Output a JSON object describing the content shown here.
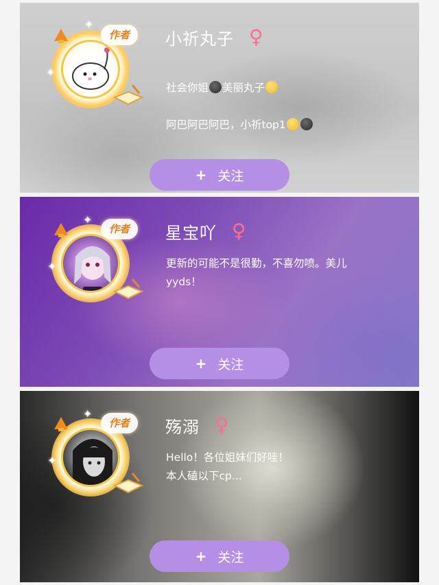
{
  "cards": [
    {
      "nickname": "小祈丸子",
      "gender_symbol": "♀",
      "author_badge": "作者",
      "bio_line1_a": "社会你姐",
      "bio_line1_b": "美丽丸子",
      "bio_line2": "阿巴阿巴阿巴，小祈top1",
      "follow_label": "关注",
      "plus": "+"
    },
    {
      "nickname": "星宝吖",
      "gender_symbol": "♀",
      "author_badge": "作者",
      "bio": "更新的可能不是很勤，不喜勿喷。美儿\nyyds！",
      "follow_label": "关注",
      "plus": "+"
    },
    {
      "nickname": "殇溺",
      "gender_symbol": "♀",
      "author_badge": "作者",
      "bio": "Hello！各位姐妹们好哇！\n本人磕以下cp...",
      "follow_label": "关注",
      "plus": "+"
    }
  ],
  "colors": {
    "follow_button": "#b58fe6",
    "gender_icon": "#ff6e8e",
    "author_badge_text": "#e0831e",
    "halo": "#f6c64a"
  }
}
